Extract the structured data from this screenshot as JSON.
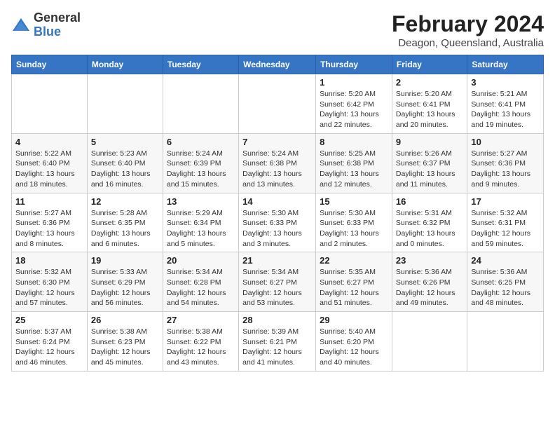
{
  "header": {
    "logo_general": "General",
    "logo_blue": "Blue",
    "month_year": "February 2024",
    "location": "Deagon, Queensland, Australia"
  },
  "weekdays": [
    "Sunday",
    "Monday",
    "Tuesday",
    "Wednesday",
    "Thursday",
    "Friday",
    "Saturday"
  ],
  "weeks": [
    [
      {
        "day": "",
        "info": ""
      },
      {
        "day": "",
        "info": ""
      },
      {
        "day": "",
        "info": ""
      },
      {
        "day": "",
        "info": ""
      },
      {
        "day": "1",
        "info": "Sunrise: 5:20 AM\nSunset: 6:42 PM\nDaylight: 13 hours\nand 22 minutes."
      },
      {
        "day": "2",
        "info": "Sunrise: 5:20 AM\nSunset: 6:41 PM\nDaylight: 13 hours\nand 20 minutes."
      },
      {
        "day": "3",
        "info": "Sunrise: 5:21 AM\nSunset: 6:41 PM\nDaylight: 13 hours\nand 19 minutes."
      }
    ],
    [
      {
        "day": "4",
        "info": "Sunrise: 5:22 AM\nSunset: 6:40 PM\nDaylight: 13 hours\nand 18 minutes."
      },
      {
        "day": "5",
        "info": "Sunrise: 5:23 AM\nSunset: 6:40 PM\nDaylight: 13 hours\nand 16 minutes."
      },
      {
        "day": "6",
        "info": "Sunrise: 5:24 AM\nSunset: 6:39 PM\nDaylight: 13 hours\nand 15 minutes."
      },
      {
        "day": "7",
        "info": "Sunrise: 5:24 AM\nSunset: 6:38 PM\nDaylight: 13 hours\nand 13 minutes."
      },
      {
        "day": "8",
        "info": "Sunrise: 5:25 AM\nSunset: 6:38 PM\nDaylight: 13 hours\nand 12 minutes."
      },
      {
        "day": "9",
        "info": "Sunrise: 5:26 AM\nSunset: 6:37 PM\nDaylight: 13 hours\nand 11 minutes."
      },
      {
        "day": "10",
        "info": "Sunrise: 5:27 AM\nSunset: 6:36 PM\nDaylight: 13 hours\nand 9 minutes."
      }
    ],
    [
      {
        "day": "11",
        "info": "Sunrise: 5:27 AM\nSunset: 6:36 PM\nDaylight: 13 hours\nand 8 minutes."
      },
      {
        "day": "12",
        "info": "Sunrise: 5:28 AM\nSunset: 6:35 PM\nDaylight: 13 hours\nand 6 minutes."
      },
      {
        "day": "13",
        "info": "Sunrise: 5:29 AM\nSunset: 6:34 PM\nDaylight: 13 hours\nand 5 minutes."
      },
      {
        "day": "14",
        "info": "Sunrise: 5:30 AM\nSunset: 6:33 PM\nDaylight: 13 hours\nand 3 minutes."
      },
      {
        "day": "15",
        "info": "Sunrise: 5:30 AM\nSunset: 6:33 PM\nDaylight: 13 hours\nand 2 minutes."
      },
      {
        "day": "16",
        "info": "Sunrise: 5:31 AM\nSunset: 6:32 PM\nDaylight: 13 hours\nand 0 minutes."
      },
      {
        "day": "17",
        "info": "Sunrise: 5:32 AM\nSunset: 6:31 PM\nDaylight: 12 hours\nand 59 minutes."
      }
    ],
    [
      {
        "day": "18",
        "info": "Sunrise: 5:32 AM\nSunset: 6:30 PM\nDaylight: 12 hours\nand 57 minutes."
      },
      {
        "day": "19",
        "info": "Sunrise: 5:33 AM\nSunset: 6:29 PM\nDaylight: 12 hours\nand 56 minutes."
      },
      {
        "day": "20",
        "info": "Sunrise: 5:34 AM\nSunset: 6:28 PM\nDaylight: 12 hours\nand 54 minutes."
      },
      {
        "day": "21",
        "info": "Sunrise: 5:34 AM\nSunset: 6:27 PM\nDaylight: 12 hours\nand 53 minutes."
      },
      {
        "day": "22",
        "info": "Sunrise: 5:35 AM\nSunset: 6:27 PM\nDaylight: 12 hours\nand 51 minutes."
      },
      {
        "day": "23",
        "info": "Sunrise: 5:36 AM\nSunset: 6:26 PM\nDaylight: 12 hours\nand 49 minutes."
      },
      {
        "day": "24",
        "info": "Sunrise: 5:36 AM\nSunset: 6:25 PM\nDaylight: 12 hours\nand 48 minutes."
      }
    ],
    [
      {
        "day": "25",
        "info": "Sunrise: 5:37 AM\nSunset: 6:24 PM\nDaylight: 12 hours\nand 46 minutes."
      },
      {
        "day": "26",
        "info": "Sunrise: 5:38 AM\nSunset: 6:23 PM\nDaylight: 12 hours\nand 45 minutes."
      },
      {
        "day": "27",
        "info": "Sunrise: 5:38 AM\nSunset: 6:22 PM\nDaylight: 12 hours\nand 43 minutes."
      },
      {
        "day": "28",
        "info": "Sunrise: 5:39 AM\nSunset: 6:21 PM\nDaylight: 12 hours\nand 41 minutes."
      },
      {
        "day": "29",
        "info": "Sunrise: 5:40 AM\nSunset: 6:20 PM\nDaylight: 12 hours\nand 40 minutes."
      },
      {
        "day": "",
        "info": ""
      },
      {
        "day": "",
        "info": ""
      }
    ]
  ]
}
